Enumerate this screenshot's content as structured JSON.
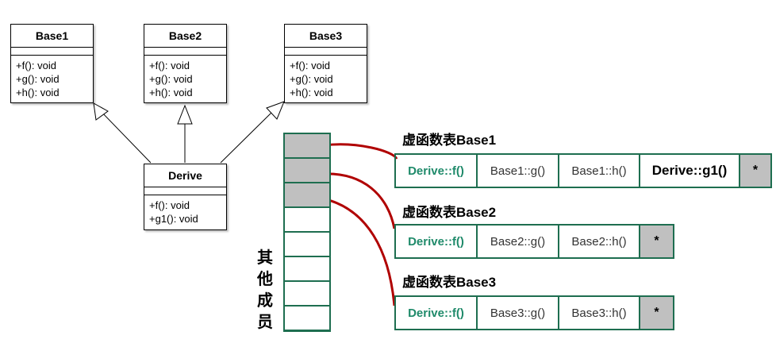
{
  "uml_classes": [
    {
      "name": "Base1",
      "ops": [
        "+f(): void",
        "+g(): void",
        "+h(): void"
      ]
    },
    {
      "name": "Base2",
      "ops": [
        "+f(): void",
        "+g(): void",
        "+h(): void"
      ]
    },
    {
      "name": "Base3",
      "ops": [
        "+f(): void",
        "+g(): void",
        "+h(): void"
      ]
    },
    {
      "name": "Derive",
      "ops": [
        "+f(): void",
        "+g1(): void"
      ]
    }
  ],
  "object_label": "其他成员",
  "vtables": [
    {
      "title": "虚函数表Base1",
      "cells": [
        "Derive::f()",
        "Base1::g()",
        "Base1::h()",
        "Derive::g1()",
        "*"
      ]
    },
    {
      "title": "虚函数表Base2",
      "cells": [
        "Derive::f()",
        "Base2::g()",
        "Base2::h()",
        "*"
      ]
    },
    {
      "title": "虚函数表Base3",
      "cells": [
        "Derive::f()",
        "Base3::g()",
        "Base3::h()",
        "*"
      ]
    }
  ],
  "colors": {
    "table_border": "#1e6e50",
    "override_text": "#1f8a6a",
    "pointer": "#b00000",
    "slot_fill": "#c0c0c0"
  }
}
